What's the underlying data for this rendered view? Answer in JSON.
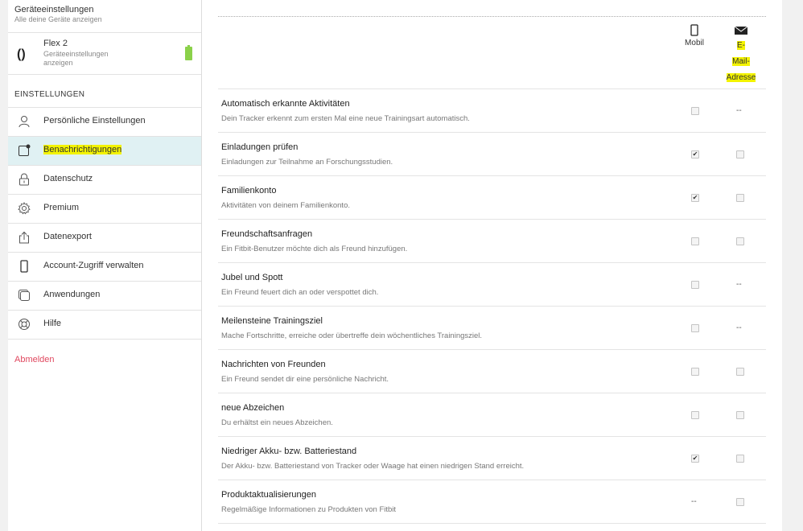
{
  "device_settings": {
    "title": "Geräteeinstellungen",
    "subtitle": "Alle deine Geräte anzeigen"
  },
  "device": {
    "name": "Flex 2",
    "settings_link": "Geräteeinstellungen anzeigen",
    "icon": "tracker-icon",
    "battery": "full",
    "battery_color": "#8bd14a"
  },
  "settings_heading": "EINSTELLUNGEN",
  "menu": [
    {
      "label": "Persönliche Einstellungen",
      "icon": "person-icon",
      "active": false
    },
    {
      "label": "Benachrichtigungen",
      "icon": "notification-icon",
      "active": true
    },
    {
      "label": "Datenschutz",
      "icon": "lock-icon",
      "active": false
    },
    {
      "label": "Premium",
      "icon": "gear-icon",
      "active": false
    },
    {
      "label": "Datenexport",
      "icon": "export-icon",
      "active": false
    },
    {
      "label": "Account-Zugriff verwalten",
      "icon": "phone-icon",
      "active": false
    },
    {
      "label": "Anwendungen",
      "icon": "apps-icon",
      "active": false
    },
    {
      "label": "Hilfe",
      "icon": "lifebuoy-icon",
      "active": false
    }
  ],
  "logout": "Abmelden",
  "columns": {
    "mobile": "Mobil",
    "email_lines": [
      "E-",
      "Mail-",
      "Adresse"
    ],
    "mobile_icon": "phone-icon",
    "email_icon": "envelope-icon"
  },
  "highlight_color": "#f3f300",
  "rows": [
    {
      "title": "Automatisch erkannte Aktivitäten",
      "desc": "Dein Tracker erkennt zum ersten Mal eine neue Trainingsart automatisch.",
      "mobile": "unchecked",
      "email": "--"
    },
    {
      "title": "Einladungen prüfen",
      "desc": "Einladungen zur Teilnahme an Forschungsstudien.",
      "mobile": "checked",
      "email": "unchecked"
    },
    {
      "title": "Familienkonto",
      "desc": "Aktivitäten von deinem Familienkonto.",
      "mobile": "checked",
      "email": "unchecked"
    },
    {
      "title": "Freundschaftsanfragen",
      "desc": "Ein Fitbit-Benutzer möchte dich als Freund hinzufügen.",
      "mobile": "unchecked",
      "email": "unchecked"
    },
    {
      "title": "Jubel und Spott",
      "desc": "Ein Freund feuert dich an oder verspottet dich.",
      "mobile": "unchecked",
      "email": "--"
    },
    {
      "title": "Meilensteine Trainingsziel",
      "desc": "Mache Fortschritte, erreiche oder übertreffe dein wöchentliches Trainingsziel.",
      "mobile": "unchecked",
      "email": "--"
    },
    {
      "title": "Nachrichten von Freunden",
      "desc": "Ein Freund sendet dir eine persönliche Nachricht.",
      "mobile": "unchecked",
      "email": "unchecked"
    },
    {
      "title": "neue Abzeichen",
      "desc": "Du erhältst ein neues Abzeichen.",
      "mobile": "unchecked",
      "email": "unchecked"
    },
    {
      "title": "Niedriger Akku- bzw. Batteriestand",
      "desc": "Der Akku- bzw. Batteriestand von Tracker oder Waage hat einen niedrigen Stand erreicht.",
      "mobile": "checked",
      "email": "unchecked"
    },
    {
      "title": "Produktaktualisierungen",
      "desc": "Regelmäßige Informationen zu Produkten von Fitbit",
      "mobile": "--",
      "email": "unchecked"
    }
  ]
}
